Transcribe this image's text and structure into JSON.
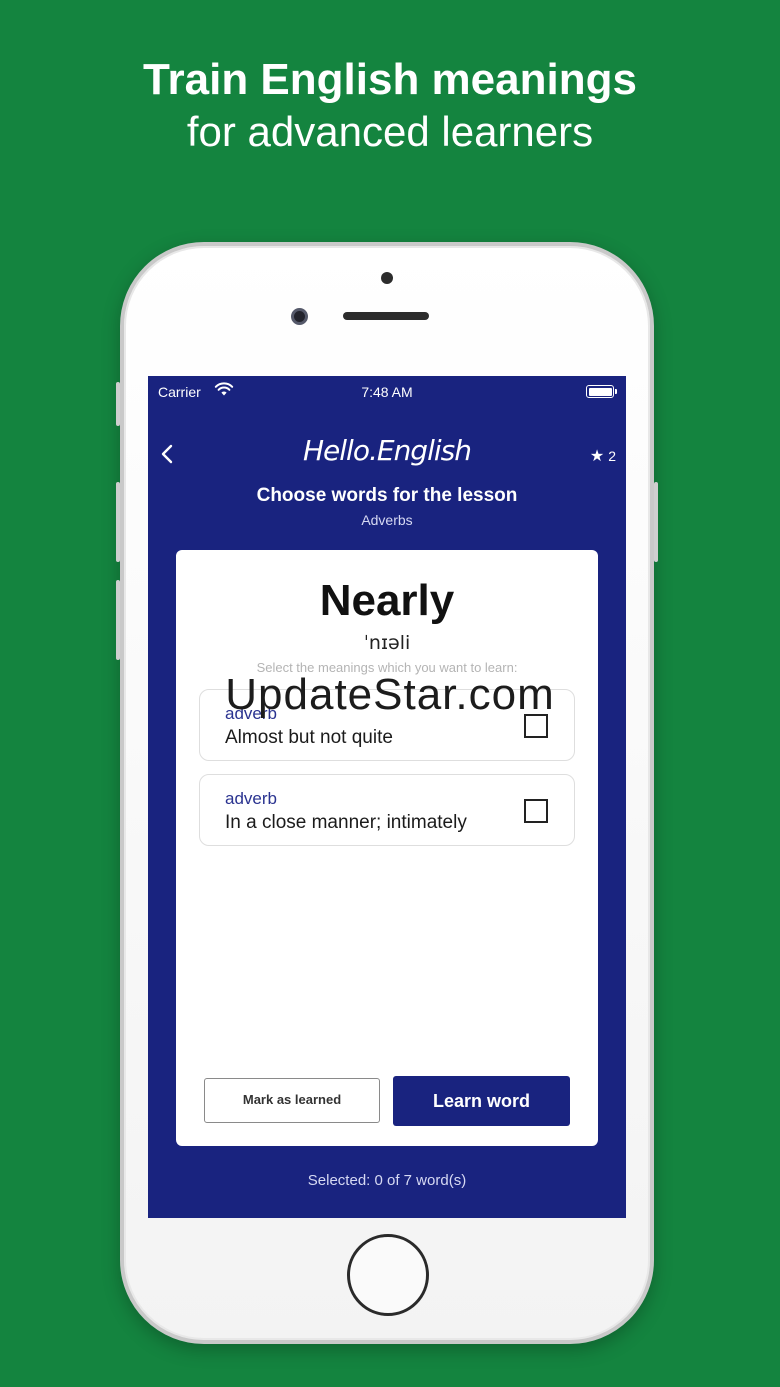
{
  "headline": {
    "line1": "Train English meanings",
    "line2": "for advanced learners"
  },
  "status_bar": {
    "carrier": "Carrier",
    "time": "7:48 AM"
  },
  "header": {
    "back_icon": "chevron-left-icon",
    "logo": "Hello.English",
    "star_icon": "star-icon",
    "star_count": "2",
    "title": "Choose words for the lesson",
    "subtitle": "Adverbs"
  },
  "card": {
    "word": "Nearly",
    "phonetic": "ˈnɪəli",
    "instruction": "Select the meanings which you want to learn:",
    "meanings": [
      {
        "pos": "adverb",
        "definition": "Almost but not quite",
        "checked": false
      },
      {
        "pos": "adverb",
        "definition": "In a close manner; intimately",
        "checked": false
      }
    ],
    "mark_button": "Mark as learned",
    "learn_button": "Learn word"
  },
  "footer": {
    "selected": "Selected: 0 of 7 word(s)"
  },
  "watermark": "UpdateStar.com",
  "colors": {
    "background": "#14843f",
    "primary": "#19237f",
    "card": "#ffffff"
  }
}
